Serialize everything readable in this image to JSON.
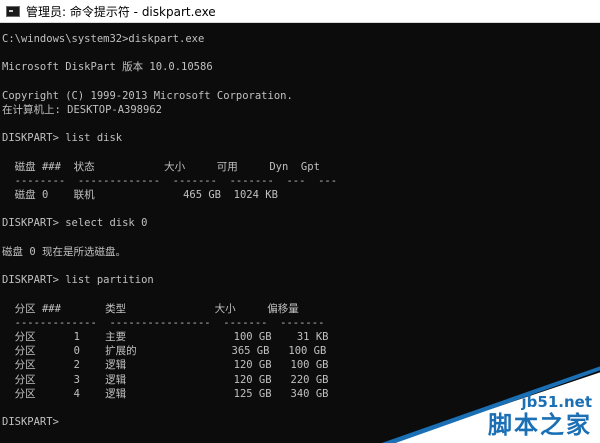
{
  "window": {
    "title": "管理员: 命令提示符 - diskpart.exe"
  },
  "console": {
    "lines": [
      "C:\\windows\\system32>diskpart.exe",
      "",
      "Microsoft DiskPart 版本 10.0.10586",
      "",
      "Copyright (C) 1999-2013 Microsoft Corporation.",
      "在计算机上: DESKTOP-A398962",
      "",
      "DISKPART> list disk",
      "",
      "  磁盘 ###  状态           大小     可用     Dyn  Gpt",
      "  --------  -------------  -------  -------  ---  ---",
      "  磁盘 0    联机              465 GB  1024 KB",
      "",
      "DISKPART> select disk 0",
      "",
      "磁盘 0 现在是所选磁盘。",
      "",
      "DISKPART> list partition",
      "",
      "  分区 ###       类型              大小     偏移量",
      "  -------------  ----------------  -------  -------",
      "  分区      1    主要                 100 GB    31 KB",
      "  分区      0    扩展的               365 GB   100 GB",
      "  分区      2    逻辑                 120 GB   100 GB",
      "  分区      3    逻辑                 120 GB   220 GB",
      "  分区      4    逻辑                 125 GB   340 GB",
      "",
      "DISKPART>"
    ]
  },
  "watermark": {
    "site": "jb51.net",
    "name": "脚本之家"
  },
  "colors": {
    "console_bg": "#0c0c0c",
    "console_text": "#c0c0c0",
    "watermark_blue": "#1a6fb5"
  }
}
